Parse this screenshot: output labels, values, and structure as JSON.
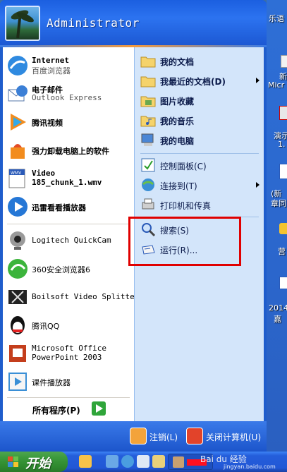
{
  "user": {
    "name": "Administrator"
  },
  "left_items": [
    {
      "title": "Internet",
      "subtitle": "百度浏览器"
    },
    {
      "title": "电子邮件",
      "subtitle": "Outlook Express"
    },
    {
      "title": "腾讯视频",
      "subtitle": ""
    },
    {
      "title": "强力卸载电脑上的软件",
      "subtitle": ""
    },
    {
      "title": "Video",
      "subtitle": "185_chunk_1.wmv"
    },
    {
      "title": "迅雷看看播放器",
      "subtitle": ""
    },
    {
      "title": "Logitech QuickCam",
      "subtitle": ""
    },
    {
      "title": "360安全浏览器6",
      "subtitle": ""
    },
    {
      "title": "Boilsoft Video Splitter",
      "subtitle": ""
    },
    {
      "title": "腾讯QQ",
      "subtitle": ""
    },
    {
      "title": "Microsoft Office",
      "subtitle": "PowerPoint 2003"
    },
    {
      "title": "课件播放器",
      "subtitle": ""
    }
  ],
  "all_programs": "所有程序(P)",
  "right_items": [
    {
      "label": "我的文档",
      "bold": true,
      "submenu": false
    },
    {
      "label": "我最近的文档(D)",
      "bold": true,
      "submenu": true
    },
    {
      "label": "图片收藏",
      "bold": true,
      "submenu": false
    },
    {
      "label": "我的音乐",
      "bold": true,
      "submenu": false
    },
    {
      "label": "我的电脑",
      "bold": true,
      "submenu": false
    },
    {
      "label": "控制面板(C)",
      "bold": false,
      "submenu": false
    },
    {
      "label": "连接到(T)",
      "bold": false,
      "submenu": true
    },
    {
      "label": "打印机和传真",
      "bold": false,
      "submenu": false
    },
    {
      "label": "搜索(S)",
      "bold": false,
      "submenu": false
    },
    {
      "label": "运行(R)...",
      "bold": false,
      "submenu": false
    }
  ],
  "footer": {
    "logoff": "注销(L)",
    "shutdown": "关闭计算机(U)"
  },
  "taskbar": {
    "start": "开始"
  },
  "desktop_icons": [
    {
      "label": "乐语"
    },
    {
      "label": "新"
    },
    {
      "label": "Micr"
    },
    {
      "label": "演示"
    },
    {
      "label": "1."
    },
    {
      "label": "(新"
    },
    {
      "label": "章同"
    },
    {
      "label": "营"
    },
    {
      "label": "2014"
    },
    {
      "label": "嘉"
    }
  ],
  "watermark": {
    "brand": "Bai du 经验",
    "url": "jingyan.baidu.com"
  },
  "colors": {
    "menu_blue": "#1f5dcc",
    "right_panel": "#d3e5fa",
    "start_green": "#3c9a3c",
    "highlight": "#e00000"
  }
}
